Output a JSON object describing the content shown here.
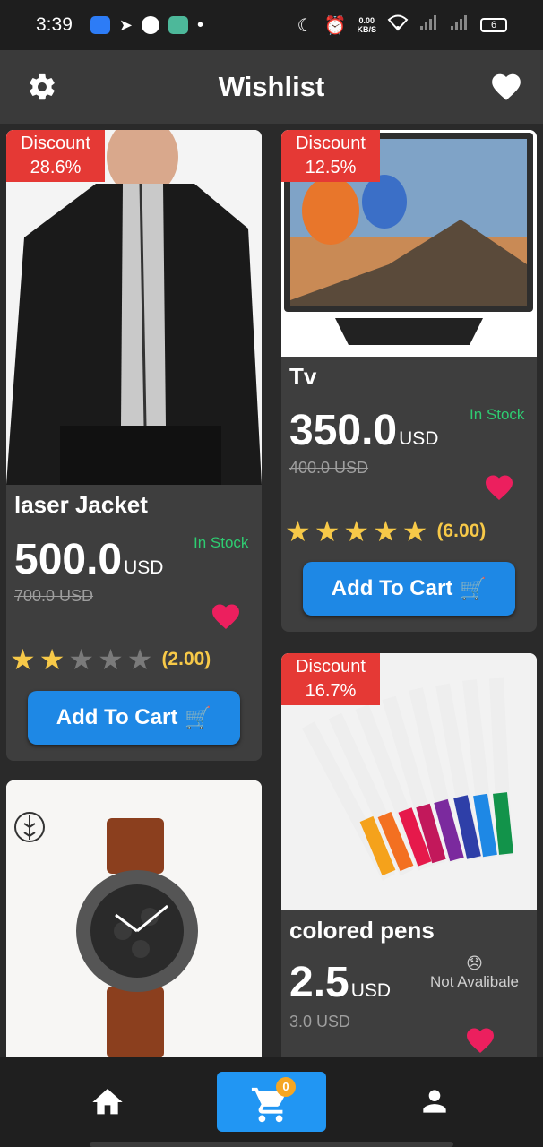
{
  "status_bar": {
    "time": "3:39",
    "speed_value": "0.00",
    "speed_unit": "KB/S",
    "battery": "6"
  },
  "app_bar": {
    "title": "Wishlist"
  },
  "products": [
    {
      "name": "laser  Jacket",
      "discount_label": "Discount",
      "discount_value": "28.6%",
      "price": "500.0",
      "currency": "USD",
      "old_price": "700.0 USD",
      "stock": "In Stock",
      "rating": "(2.00)",
      "rating_value": 2,
      "cart_label": "Add To Cart"
    },
    {
      "name": "Tv",
      "discount_label": "Discount",
      "discount_value": "12.5%",
      "price": "350.0",
      "currency": "USD",
      "old_price": "400.0 USD",
      "stock": "In Stock",
      "rating": "(6.00)",
      "rating_value": 5,
      "cart_label": "Add To Cart"
    },
    {
      "name": "colored  pens",
      "discount_label": "Discount",
      "discount_value": "16.7%",
      "price": "2.5",
      "currency": "USD",
      "old_price": "3.0 USD",
      "stock": "Not Avalibale",
      "stock_emoji": "😞"
    },
    {
      "name": "watch"
    }
  ],
  "bottom_nav": {
    "cart_count": "0"
  },
  "colors": {
    "accent": "#1e88e5",
    "discount": "#e53935",
    "in_stock": "#2ecc71",
    "heart": "#ec1f5e",
    "star": "#f7c948"
  }
}
